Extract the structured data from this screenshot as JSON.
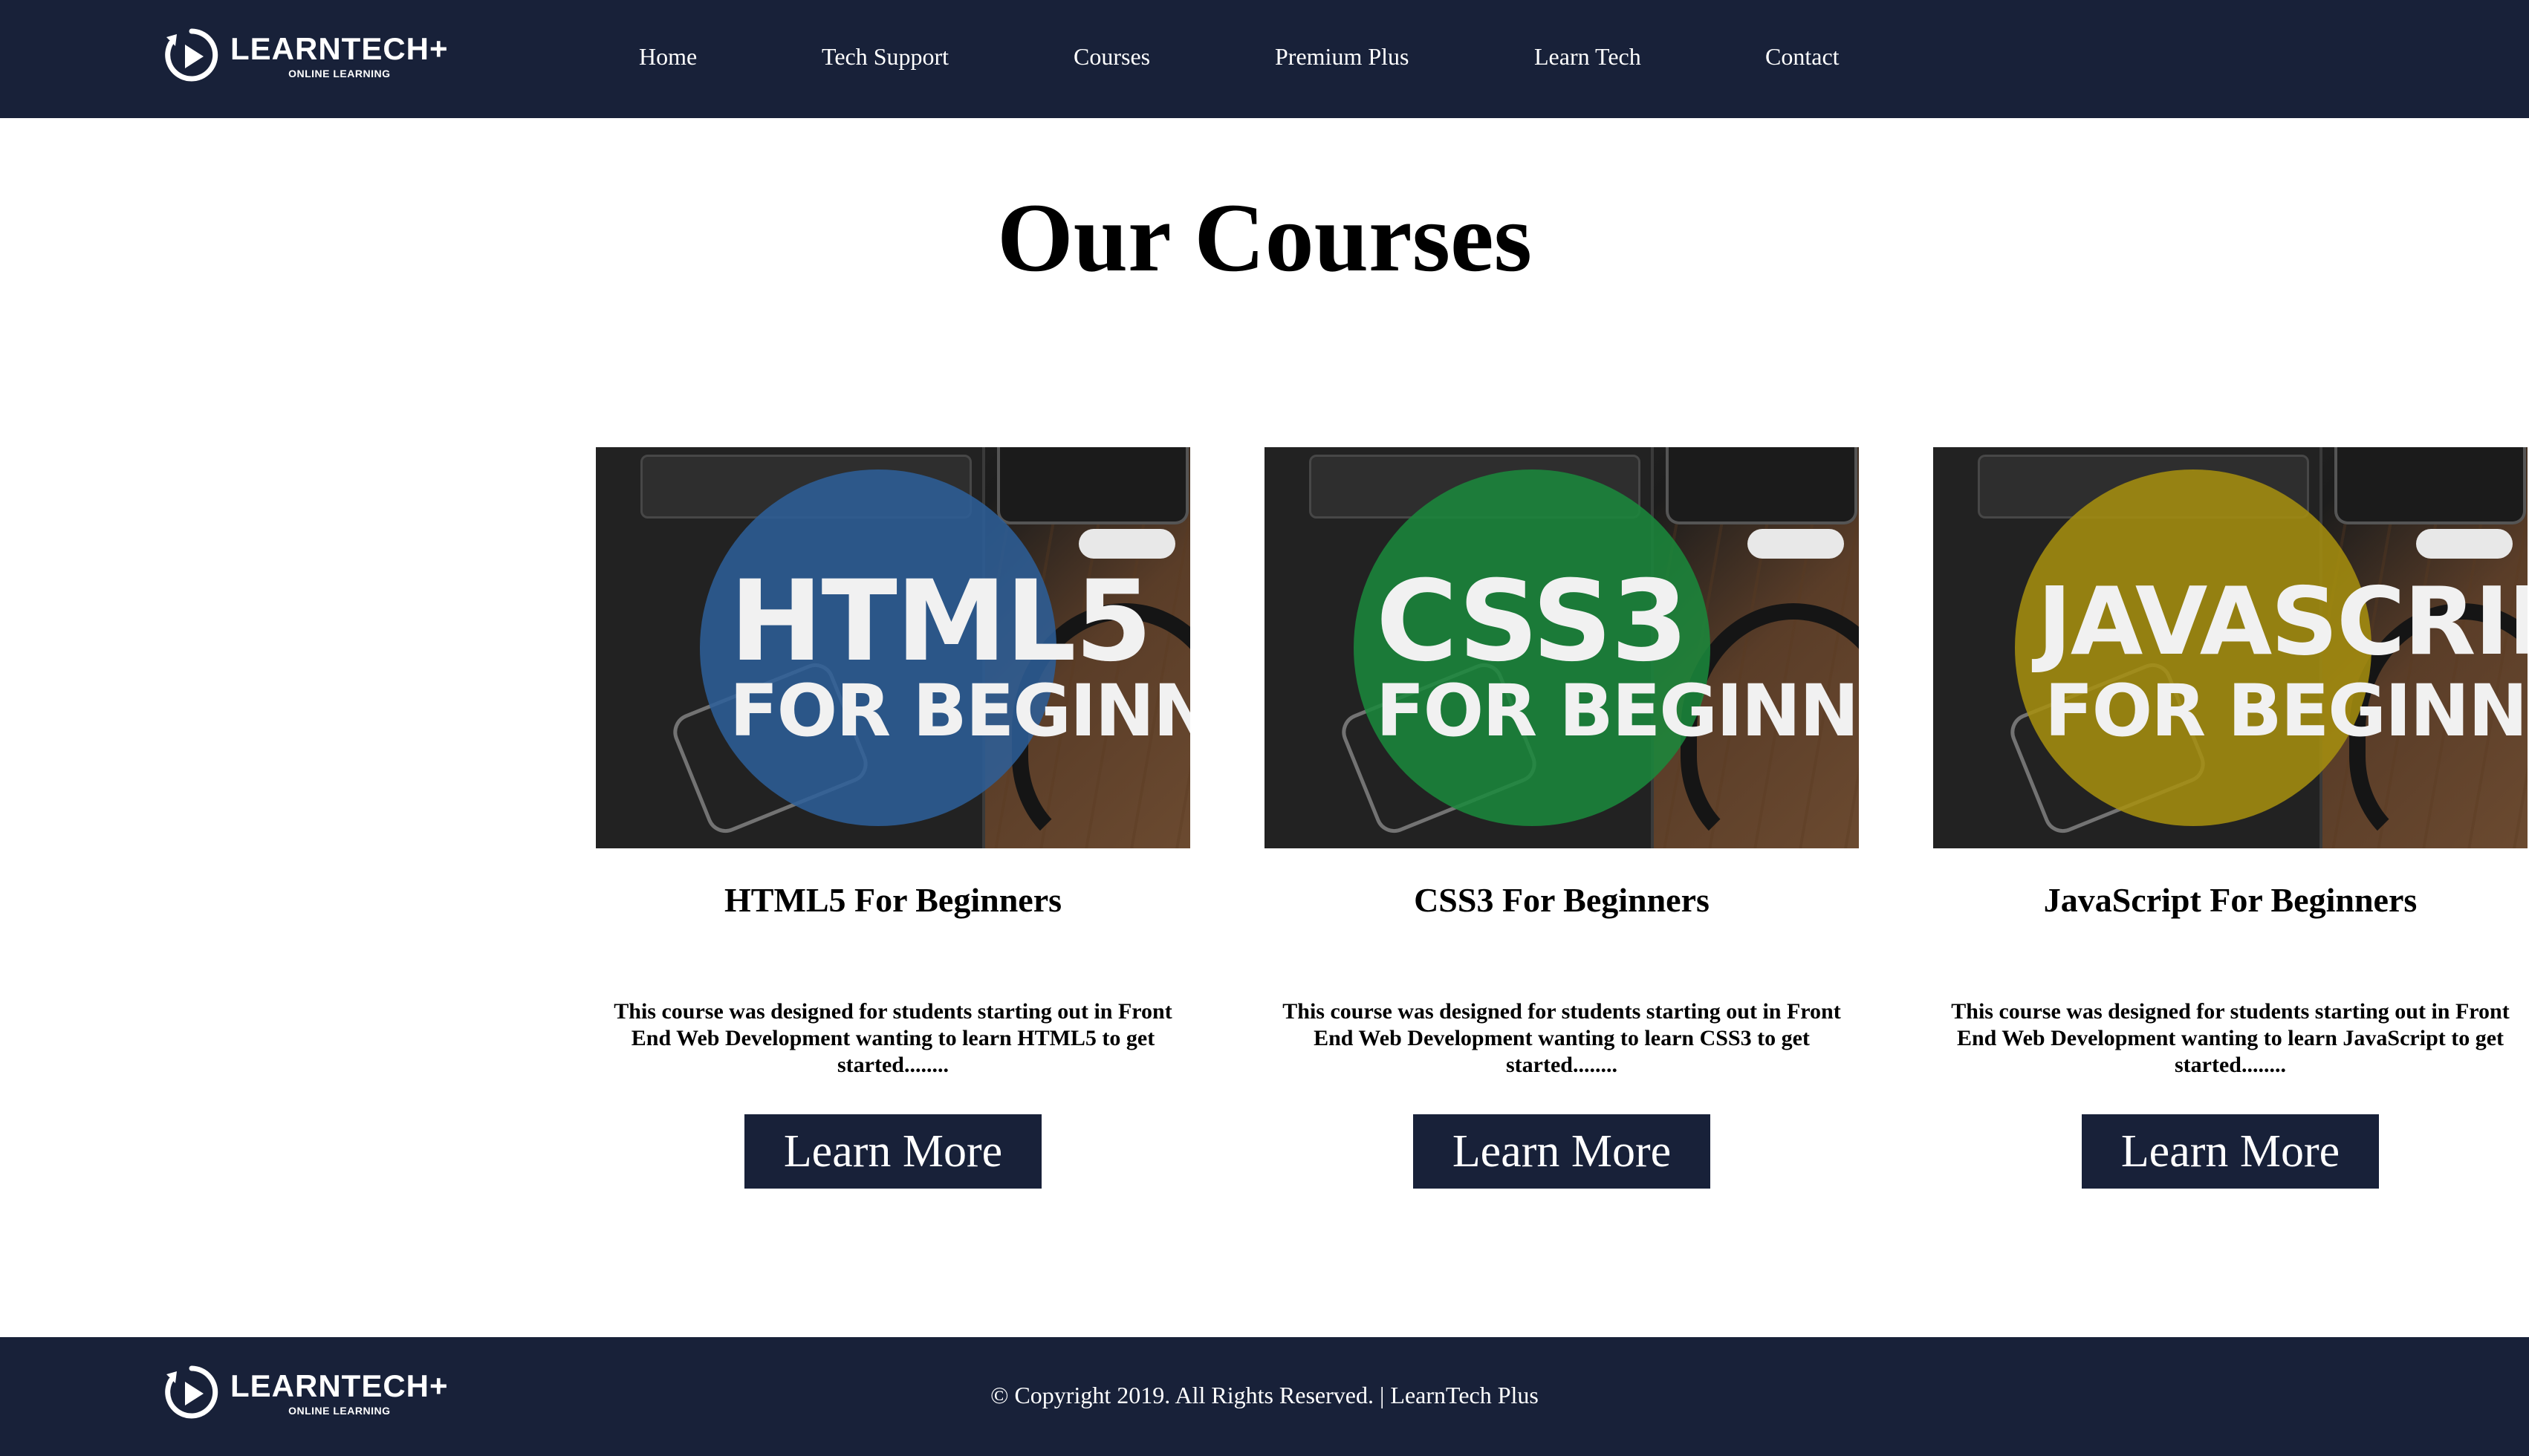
{
  "brand": {
    "name": "LEARNTECH+",
    "tagline": "ONLINE LEARNING"
  },
  "nav": {
    "items": [
      "Home",
      "Tech Support",
      "Courses",
      "Premium Plus",
      "Learn Tech",
      "Contact"
    ]
  },
  "main": {
    "title": "Our Courses"
  },
  "courses": [
    {
      "image_line1": "HTML5",
      "image_line2": "FOR BEGINNERS",
      "image_color": "#2d5f9a",
      "title": "HTML5 For Beginners",
      "description": "This course was designed for students starting out in Front End Web Development wanting to learn HTML5 to get started........",
      "button_label": "Learn More"
    },
    {
      "image_line1": "CSS3",
      "image_line2": "FOR BEGINNERS",
      "image_color": "#1a8a3c",
      "title": "CSS3 For Beginners",
      "description": "This course was designed for students starting out in Front End Web Development wanting to learn CSS3 to get started........",
      "button_label": "Learn More"
    },
    {
      "image_line1": "JAVASCRIPT",
      "image_line2": "FOR BEGINNERS",
      "image_color": "#a8900e",
      "title": "JavaScript For Beginners",
      "description": "This course was designed for students starting out in Front End Web Development wanting to learn JavaScript to get started........",
      "button_label": "Learn More"
    }
  ],
  "footer": {
    "copyright": "© Copyright 2019. All Rights Reserved. | LearnTech Plus"
  },
  "colors": {
    "navy": "#182139",
    "white": "#ffffff"
  }
}
